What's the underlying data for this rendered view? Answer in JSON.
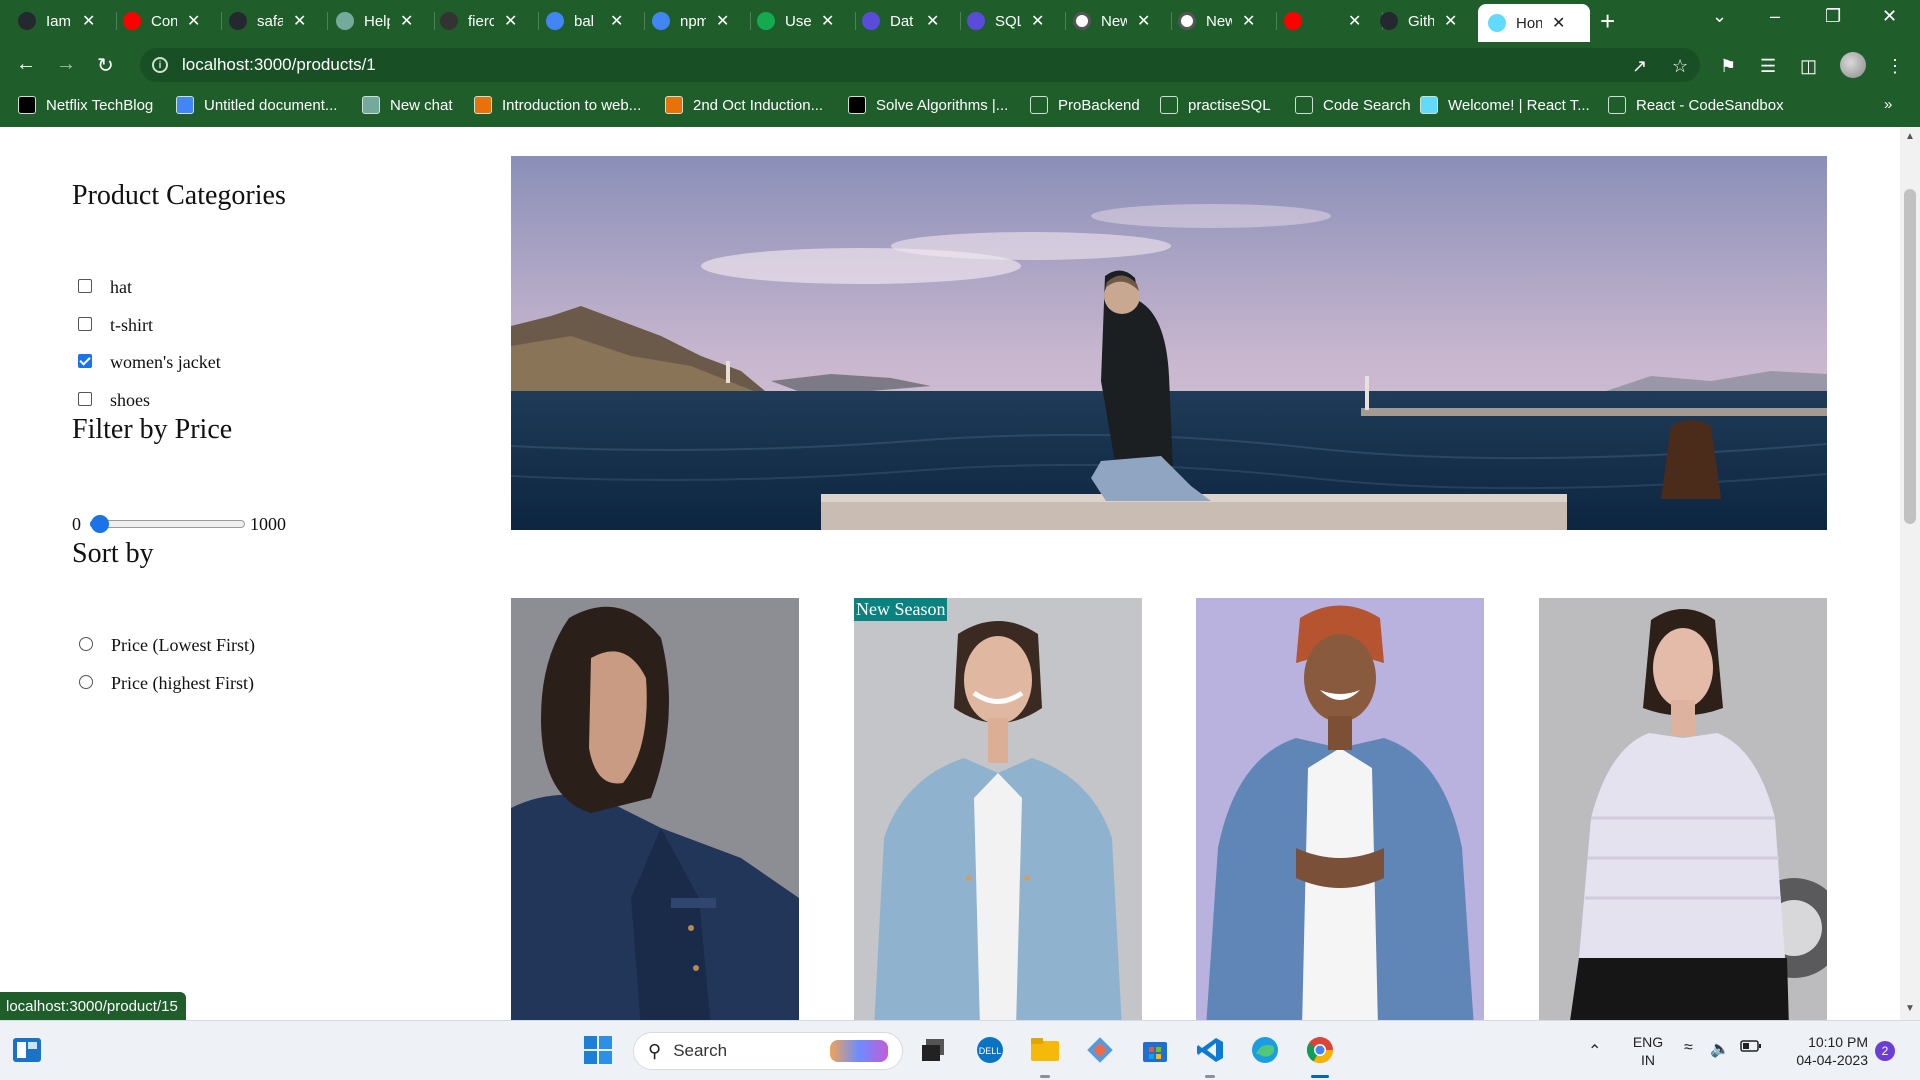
{
  "browser": {
    "tabs": [
      {
        "label": "Iam",
        "icon": "github-icon",
        "color": "#24292f"
      },
      {
        "label": "Con",
        "icon": "youtube-icon",
        "color": "#ff0000"
      },
      {
        "label": "safa",
        "icon": "github-icon",
        "color": "#24292f"
      },
      {
        "label": "Help",
        "icon": "chatgpt-icon",
        "color": "#74aa9c"
      },
      {
        "label": "fierc",
        "icon": "site-icon",
        "color": "#333333"
      },
      {
        "label": "bal",
        "icon": "google-icon",
        "color": "#4285f4"
      },
      {
        "label": "npm",
        "icon": "google-icon",
        "color": "#4285f4"
      },
      {
        "label": "Use",
        "icon": "mongodb-icon",
        "color": "#13aa52"
      },
      {
        "label": "Dat",
        "icon": "database-icon",
        "color": "#5b4bdb"
      },
      {
        "label": "SQL",
        "icon": "database-icon",
        "color": "#5b4bdb"
      },
      {
        "label": "New",
        "icon": "chrome-icon",
        "color": "#ffffff"
      },
      {
        "label": "New",
        "icon": "chrome-icon",
        "color": "#ffffff"
      },
      {
        "label": "",
        "icon": "youtube-icon",
        "color": "#ff0000"
      },
      {
        "label": "Gith",
        "icon": "github-icon",
        "color": "#24292f"
      },
      {
        "label": "Hon",
        "icon": "react-icon",
        "color": "#61dafb",
        "active": true
      }
    ],
    "url": "localhost:3000/products/1",
    "bookmarks": [
      {
        "label": "Netflix TechBlog",
        "icon": "medium-icon"
      },
      {
        "label": "Untitled document...",
        "icon": "docs-icon"
      },
      {
        "label": "New chat",
        "icon": "chatgpt-icon"
      },
      {
        "label": "Introduction to web...",
        "icon": "course-icon"
      },
      {
        "label": "2nd Oct Induction...",
        "icon": "course-icon"
      },
      {
        "label": "Solve Algorithms |...",
        "icon": "hackerrank-icon"
      },
      {
        "label": "ProBackend",
        "icon": "code-icon"
      },
      {
        "label": "practiseSQL",
        "icon": "db-icon"
      },
      {
        "label": "Code Search",
        "icon": "code-search-icon"
      },
      {
        "label": "Welcome! | React T...",
        "icon": "react-icon"
      },
      {
        "label": "React - CodeSandbox",
        "icon": "codesandbox-icon"
      }
    ],
    "status_url": "localhost:3000/product/15"
  },
  "sidebar": {
    "categories_title": "Product Categories",
    "categories": [
      {
        "label": "hat",
        "checked": false
      },
      {
        "label": "t-shirt",
        "checked": false
      },
      {
        "label": "women's jacket",
        "checked": true
      },
      {
        "label": "shoes",
        "checked": false
      }
    ],
    "price_title": "Filter by Price",
    "price_min": "0",
    "price_max": "1000",
    "price_value_fraction": 0,
    "sort_title": "Sort by",
    "sort_options": [
      {
        "label": "Price (Lowest First)"
      },
      {
        "label": "Price (highest First)"
      }
    ]
  },
  "products": [
    {
      "badge": "",
      "jacket_color": "#22365a"
    },
    {
      "badge": "New Season",
      "jacket_color": "#8fb2cf"
    },
    {
      "badge": "",
      "jacket_color": "#5f86b6"
    },
    {
      "badge": "",
      "jacket_color": "#e4e2ee"
    }
  ],
  "taskbar": {
    "search_placeholder": "Search",
    "lang_line1": "ENG",
    "lang_line2": "IN",
    "time": "10:10 PM",
    "date": "04-04-2023",
    "notification_count": "2"
  }
}
